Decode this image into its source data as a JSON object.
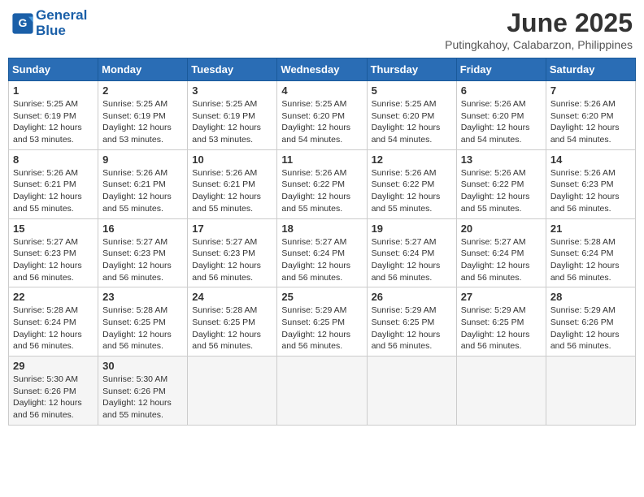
{
  "header": {
    "logo_line1": "General",
    "logo_line2": "Blue",
    "month_title": "June 2025",
    "location": "Putingkahoy, Calabarzon, Philippines"
  },
  "weekdays": [
    "Sunday",
    "Monday",
    "Tuesday",
    "Wednesday",
    "Thursday",
    "Friday",
    "Saturday"
  ],
  "weeks": [
    [
      {
        "day": "1",
        "sunrise": "5:25 AM",
        "sunset": "6:19 PM",
        "daylight": "12 hours and 53 minutes."
      },
      {
        "day": "2",
        "sunrise": "5:25 AM",
        "sunset": "6:19 PM",
        "daylight": "12 hours and 53 minutes."
      },
      {
        "day": "3",
        "sunrise": "5:25 AM",
        "sunset": "6:19 PM",
        "daylight": "12 hours and 53 minutes."
      },
      {
        "day": "4",
        "sunrise": "5:25 AM",
        "sunset": "6:20 PM",
        "daylight": "12 hours and 54 minutes."
      },
      {
        "day": "5",
        "sunrise": "5:25 AM",
        "sunset": "6:20 PM",
        "daylight": "12 hours and 54 minutes."
      },
      {
        "day": "6",
        "sunrise": "5:26 AM",
        "sunset": "6:20 PM",
        "daylight": "12 hours and 54 minutes."
      },
      {
        "day": "7",
        "sunrise": "5:26 AM",
        "sunset": "6:20 PM",
        "daylight": "12 hours and 54 minutes."
      }
    ],
    [
      {
        "day": "8",
        "sunrise": "5:26 AM",
        "sunset": "6:21 PM",
        "daylight": "12 hours and 55 minutes."
      },
      {
        "day": "9",
        "sunrise": "5:26 AM",
        "sunset": "6:21 PM",
        "daylight": "12 hours and 55 minutes."
      },
      {
        "day": "10",
        "sunrise": "5:26 AM",
        "sunset": "6:21 PM",
        "daylight": "12 hours and 55 minutes."
      },
      {
        "day": "11",
        "sunrise": "5:26 AM",
        "sunset": "6:22 PM",
        "daylight": "12 hours and 55 minutes."
      },
      {
        "day": "12",
        "sunrise": "5:26 AM",
        "sunset": "6:22 PM",
        "daylight": "12 hours and 55 minutes."
      },
      {
        "day": "13",
        "sunrise": "5:26 AM",
        "sunset": "6:22 PM",
        "daylight": "12 hours and 55 minutes."
      },
      {
        "day": "14",
        "sunrise": "5:26 AM",
        "sunset": "6:23 PM",
        "daylight": "12 hours and 56 minutes."
      }
    ],
    [
      {
        "day": "15",
        "sunrise": "5:27 AM",
        "sunset": "6:23 PM",
        "daylight": "12 hours and 56 minutes."
      },
      {
        "day": "16",
        "sunrise": "5:27 AM",
        "sunset": "6:23 PM",
        "daylight": "12 hours and 56 minutes."
      },
      {
        "day": "17",
        "sunrise": "5:27 AM",
        "sunset": "6:23 PM",
        "daylight": "12 hours and 56 minutes."
      },
      {
        "day": "18",
        "sunrise": "5:27 AM",
        "sunset": "6:24 PM",
        "daylight": "12 hours and 56 minutes."
      },
      {
        "day": "19",
        "sunrise": "5:27 AM",
        "sunset": "6:24 PM",
        "daylight": "12 hours and 56 minutes."
      },
      {
        "day": "20",
        "sunrise": "5:27 AM",
        "sunset": "6:24 PM",
        "daylight": "12 hours and 56 minutes."
      },
      {
        "day": "21",
        "sunrise": "5:28 AM",
        "sunset": "6:24 PM",
        "daylight": "12 hours and 56 minutes."
      }
    ],
    [
      {
        "day": "22",
        "sunrise": "5:28 AM",
        "sunset": "6:24 PM",
        "daylight": "12 hours and 56 minutes."
      },
      {
        "day": "23",
        "sunrise": "5:28 AM",
        "sunset": "6:25 PM",
        "daylight": "12 hours and 56 minutes."
      },
      {
        "day": "24",
        "sunrise": "5:28 AM",
        "sunset": "6:25 PM",
        "daylight": "12 hours and 56 minutes."
      },
      {
        "day": "25",
        "sunrise": "5:29 AM",
        "sunset": "6:25 PM",
        "daylight": "12 hours and 56 minutes."
      },
      {
        "day": "26",
        "sunrise": "5:29 AM",
        "sunset": "6:25 PM",
        "daylight": "12 hours and 56 minutes."
      },
      {
        "day": "27",
        "sunrise": "5:29 AM",
        "sunset": "6:25 PM",
        "daylight": "12 hours and 56 minutes."
      },
      {
        "day": "28",
        "sunrise": "5:29 AM",
        "sunset": "6:26 PM",
        "daylight": "12 hours and 56 minutes."
      }
    ],
    [
      {
        "day": "29",
        "sunrise": "5:30 AM",
        "sunset": "6:26 PM",
        "daylight": "12 hours and 56 minutes."
      },
      {
        "day": "30",
        "sunrise": "5:30 AM",
        "sunset": "6:26 PM",
        "daylight": "12 hours and 55 minutes."
      },
      null,
      null,
      null,
      null,
      null
    ]
  ],
  "labels": {
    "sunrise": "Sunrise:",
    "sunset": "Sunset:",
    "daylight": "Daylight:"
  }
}
